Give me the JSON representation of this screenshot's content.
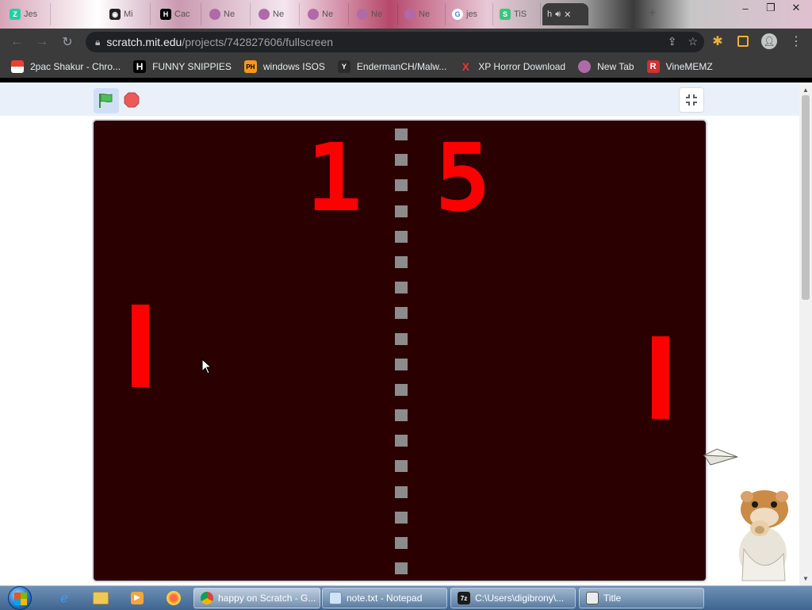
{
  "browser": {
    "tabs": [
      {
        "label": "Jes",
        "icon": "zap-icon",
        "color": "#1fd1a3"
      },
      {
        "label": "Mi",
        "icon": "github-icon",
        "color": "#222222"
      },
      {
        "label": "Cac",
        "icon": "h-icon",
        "color": "#000000"
      },
      {
        "label": "Ne",
        "icon": "planet-icon",
        "color": "#b06aa8"
      },
      {
        "label": "Ne",
        "icon": "planet-icon",
        "color": "#b06aa8"
      },
      {
        "label": "Ne",
        "icon": "planet-icon",
        "color": "#b06aa8"
      },
      {
        "label": "Ne",
        "icon": "planet-icon",
        "color": "#b06aa8"
      },
      {
        "label": "Ne",
        "icon": "planet-icon",
        "color": "#b06aa8"
      },
      {
        "label": "jes",
        "icon": "google-icon",
        "color": "#ffffff"
      },
      {
        "label": "TiS",
        "icon": "stamp-icon",
        "color": "#3ac47d"
      },
      {
        "label": "h",
        "icon": "scratch-icon",
        "color": "#ff9900",
        "active": true
      }
    ],
    "url": {
      "host": "scratch.mit.edu",
      "path": "/projects/742827606/fullscreen"
    },
    "bookmarks": [
      {
        "label": "2pac Shakur - Chro...",
        "icon": "store-icon",
        "color": "#e94235"
      },
      {
        "label": "FUNNY SNIPPIES",
        "icon": "h-icon",
        "color": "#000000",
        "glyph": "H"
      },
      {
        "label": "windows ISOS",
        "icon": "ph-icon",
        "color": "#f7971e",
        "glyph": "PH"
      },
      {
        "label": "EndermanCH/Malw...",
        "icon": "youtube-icon",
        "color": "#2b2b2b",
        "glyph": "Y"
      },
      {
        "label": "XP Horror Download",
        "icon": "x-icon",
        "color": "#e53935",
        "glyph": "X"
      },
      {
        "label": "New Tab",
        "icon": "planet-icon",
        "color": "#b06aa8",
        "glyph": ""
      },
      {
        "label": "VineMEMZ",
        "icon": "r-icon",
        "color": "#d32f2f",
        "glyph": "R"
      }
    ]
  },
  "game": {
    "score_left": "1",
    "score_right": "5",
    "stage_bg": "#2a0000",
    "paddle_color": "#ff0000"
  },
  "taskbar": {
    "tasks": [
      {
        "label": "happy on Scratch - G...",
        "icon": "chrome-icon",
        "active": true
      },
      {
        "label": "note.txt - Notepad",
        "icon": "notepad-icon"
      },
      {
        "label": "C:\\Users\\digibrony\\...",
        "icon": "7zip-icon"
      },
      {
        "label": "Title",
        "icon": "window-icon"
      }
    ]
  }
}
